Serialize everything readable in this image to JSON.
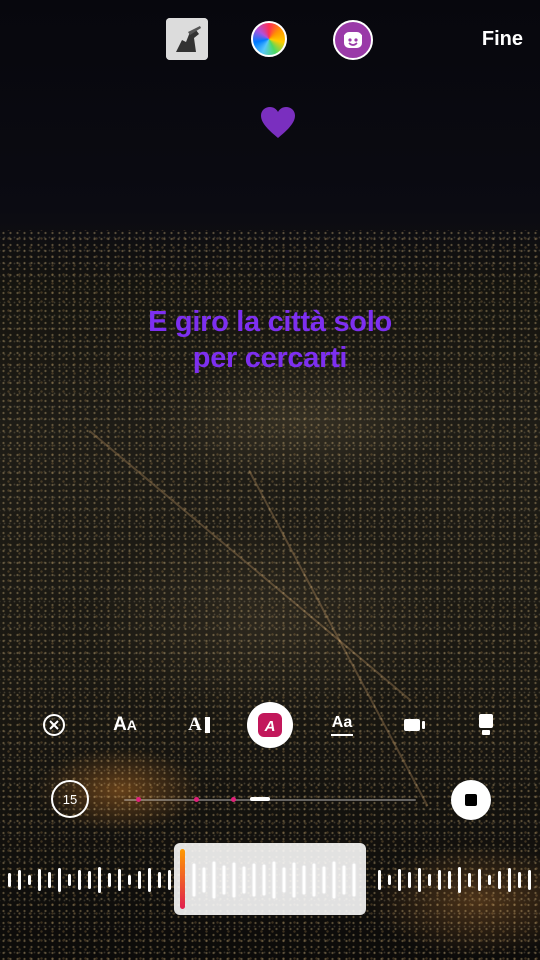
{
  "header": {
    "done_label": "Fine",
    "thumbnail_icon": "album-cover-icon",
    "color_icon": "color-wheel-icon",
    "sticker_icon": "sticker-face-icon"
  },
  "sticker": {
    "icon": "purple-heart-icon",
    "color": "#7a2fbf"
  },
  "lyrics": {
    "line1": "E giro la città solo",
    "line2": "per cercarti",
    "color": "#7d2ff0"
  },
  "toolbar": {
    "items": [
      {
        "icon": "remove-icon",
        "label": ""
      },
      {
        "icon": "text-size-aa-icon",
        "label": "AA"
      },
      {
        "icon": "text-cursor-icon",
        "label": "A"
      },
      {
        "icon": "text-style-a-icon",
        "label": "A"
      },
      {
        "icon": "text-underline-aa-icon",
        "label": "Aa"
      },
      {
        "icon": "video-clip-icon",
        "label": ""
      },
      {
        "icon": "card-style-icon",
        "label": ""
      }
    ],
    "active_index": 3,
    "accent": "#c2185b"
  },
  "playback": {
    "duration_label": "15",
    "stop_icon": "stop-icon",
    "marker_color": "#e0207a"
  },
  "waveform": {
    "selection_start_color": "#ff9a00",
    "selection_end_color": "#e01f4f"
  }
}
